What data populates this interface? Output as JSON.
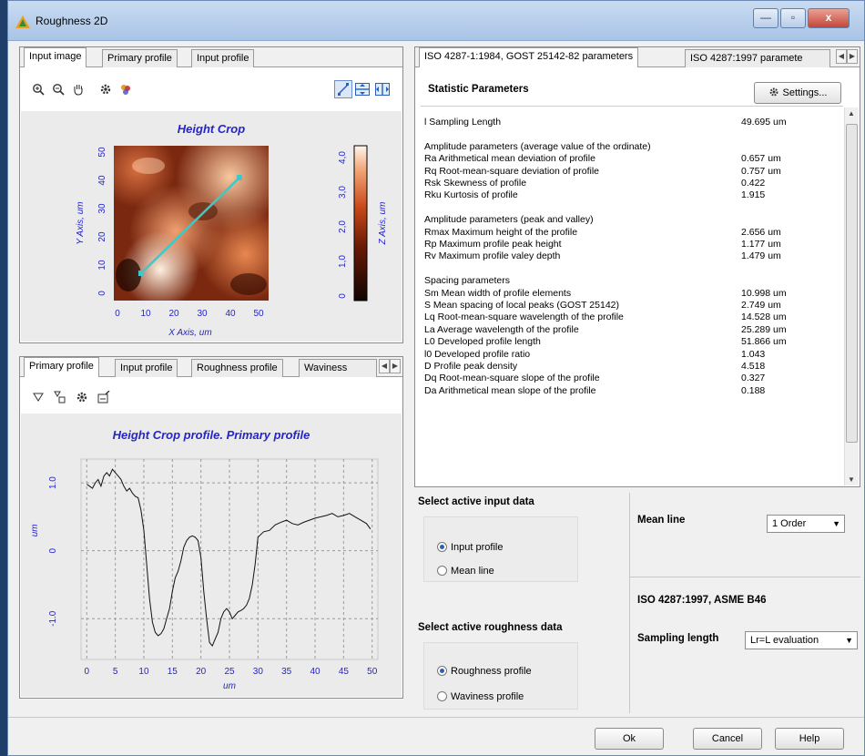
{
  "window": {
    "title": "Roughness 2D",
    "controls": {
      "minimize": "—",
      "maximize": "▫",
      "close": "x"
    }
  },
  "top_left_panel": {
    "tabs": [
      "Input image",
      "Primary profile",
      "Input profile"
    ],
    "active_tab": 0,
    "toolbar_icons": [
      "zoom-in-icon",
      "zoom-out-icon",
      "pan-hand-icon",
      "gear-icon",
      "palette-icon",
      "line-tool-icon",
      "horizontal-range-icon",
      "vertical-range-icon"
    ],
    "image_title": "Height Crop",
    "x_axis_label": "X Axis, um",
    "y_axis_label": "Y Axis, um",
    "z_axis_label": "Z Axis, um",
    "x_ticks": [
      "0",
      "10",
      "20",
      "30",
      "40",
      "50"
    ],
    "y_ticks": [
      "0",
      "10",
      "20",
      "30",
      "40",
      "50"
    ],
    "z_ticks": [
      "0",
      "1,0",
      "2,0",
      "3,0",
      "4,0"
    ],
    "line_color": "#3ec8c8"
  },
  "bottom_left_panel": {
    "tabs": [
      "Primary profile",
      "Input profile",
      "Roughness profile",
      "Waviness"
    ],
    "active_tab": 0,
    "toolbar_icons": [
      "triangle-down-icon",
      "copy-shapes-icon",
      "gear-icon",
      "export-icon"
    ]
  },
  "chart_data": {
    "type": "line",
    "title": "Height Crop profile. Primary profile",
    "xlabel": "um",
    "ylabel": "um",
    "x_ticks": [
      "0",
      "5",
      "10",
      "15",
      "20",
      "25",
      "30",
      "35",
      "40",
      "45",
      "50"
    ],
    "y_ticks": [
      "1.0",
      "0",
      "-1.0"
    ],
    "xlim": [
      -1,
      51
    ],
    "ylim": [
      -1.6,
      1.35
    ],
    "grid": true,
    "series": [
      {
        "x": [
          0,
          0.5,
          1,
          1.5,
          2,
          2.5,
          3,
          3.5,
          4,
          4.5,
          5,
          5.5,
          6,
          6.5,
          7,
          7.5,
          8,
          8.5,
          9,
          9.5,
          10,
          10.5,
          11,
          11.5,
          12,
          12.5,
          13,
          13.5,
          14,
          14.5,
          15,
          15.5,
          16,
          16.5,
          17,
          17.5,
          18,
          18.5,
          19,
          19.5,
          20,
          20.5,
          21,
          21.5,
          22,
          22.5,
          23,
          23.5,
          24,
          24.5,
          25,
          25.5,
          26,
          26.5,
          27,
          27.5,
          28,
          28.5,
          29,
          29.5,
          30,
          31,
          32,
          33,
          34,
          35,
          36,
          37,
          38,
          39,
          40,
          41,
          42,
          43,
          44,
          45,
          46,
          47,
          48,
          49,
          49.7
        ],
        "values": [
          0.98,
          0.95,
          0.92,
          1.0,
          1.05,
          0.95,
          1.1,
          1.15,
          1.1,
          1.2,
          1.15,
          1.1,
          1.05,
          0.95,
          0.88,
          0.92,
          0.85,
          0.8,
          0.78,
          0.6,
          0.3,
          -0.2,
          -0.7,
          -1.05,
          -1.2,
          -1.25,
          -1.22,
          -1.15,
          -1.0,
          -0.85,
          -0.6,
          -0.4,
          -0.3,
          -0.15,
          0.05,
          0.15,
          0.2,
          0.22,
          0.2,
          0.15,
          -0.1,
          -0.6,
          -1.0,
          -1.35,
          -1.4,
          -1.3,
          -1.2,
          -1.0,
          -0.9,
          -0.85,
          -0.9,
          -1.0,
          -0.95,
          -0.9,
          -0.88,
          -0.85,
          -0.8,
          -0.7,
          -0.5,
          -0.2,
          0.2,
          0.28,
          0.3,
          0.38,
          0.42,
          0.45,
          0.4,
          0.38,
          0.42,
          0.45,
          0.48,
          0.5,
          0.52,
          0.55,
          0.5,
          0.52,
          0.55,
          0.5,
          0.45,
          0.4,
          0.32
        ]
      }
    ]
  },
  "right_panel": {
    "tabs": [
      "ISO 4287-1:1984, GOST 25142-82 parameters",
      "ISO 4287:1997 paramete"
    ],
    "active_tab": 0,
    "header": "Statistic Parameters",
    "settings_button": "Settings...",
    "rows": [
      {
        "label": "l   Sampling Length",
        "value": "49.695 um"
      },
      {
        "label": "",
        "value": ""
      },
      {
        "label": "Amplitude parameters (average value of the ordinate)",
        "value": ""
      },
      {
        "label": "Ra   Arithmetical mean deviation of profile",
        "value": "0.657 um"
      },
      {
        "label": "Rq   Root-mean-square deviation of profile",
        "value": "0.757 um"
      },
      {
        "label": "Rsk   Skewness of profile",
        "value": "0.422"
      },
      {
        "label": "Rku   Kurtosis of profile",
        "value": "1.915"
      },
      {
        "label": "",
        "value": ""
      },
      {
        "label": "Amplitude parameters (peak and valley)",
        "value": ""
      },
      {
        "label": "Rmax   Maximum height of the profile",
        "value": "2.656 um"
      },
      {
        "label": "Rp   Maximum profile peak height",
        "value": "1.177 um"
      },
      {
        "label": "Rv   Maximum profile valey depth",
        "value": "1.479 um"
      },
      {
        "label": "",
        "value": ""
      },
      {
        "label": "Spacing parameters",
        "value": ""
      },
      {
        "label": "Sm   Mean width of profile elements",
        "value": "10.998 um"
      },
      {
        "label": "S   Mean spacing of local peaks (GOST 25142)",
        "value": "2.749 um"
      },
      {
        "label": "Lq   Root-mean-square wavelength of the profile",
        "value": "14.528 um"
      },
      {
        "label": "La   Average wavelength of the profile",
        "value": "25.289 um"
      },
      {
        "label": "L0   Developed profile length",
        "value": "51.866 um"
      },
      {
        "label": "l0   Developed profile ratio",
        "value": "1.043"
      },
      {
        "label": "D   Profile peak density",
        "value": "4.518"
      },
      {
        "label": "Dq   Root-mean-square slope of the profile",
        "value": "0.327"
      },
      {
        "label": "Da   Arithmetical mean slope of the profile",
        "value": "0.188"
      }
    ]
  },
  "input_data": {
    "title": "Select active input data",
    "options": [
      "Input profile",
      "Mean line"
    ],
    "selected": 0
  },
  "roughness_data": {
    "title": "Select active roughness data",
    "options": [
      "Roughness profile",
      "Waviness profile"
    ],
    "selected": 0
  },
  "mean_line": {
    "label": "Mean line",
    "value": "1 Order"
  },
  "iso_section": {
    "title": "ISO 4287:1997, ASME B46",
    "sampling_label": "Sampling length",
    "sampling_value": "Lr=L evaluation"
  },
  "buttons": {
    "ok": "Ok",
    "cancel": "Cancel",
    "help": "Help"
  }
}
